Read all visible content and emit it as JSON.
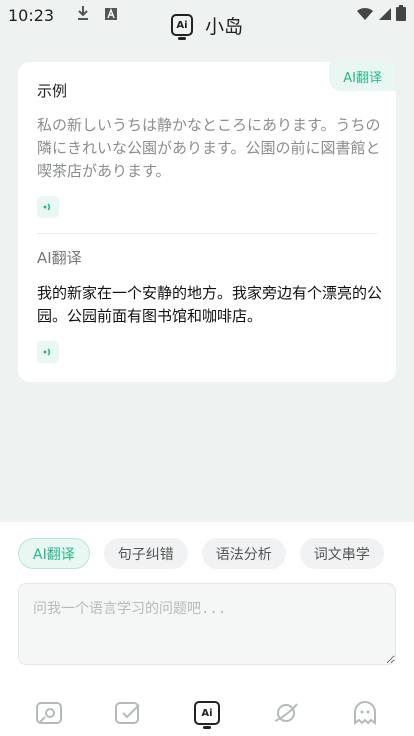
{
  "status": {
    "time": "10:23"
  },
  "header": {
    "logo_text": "Ai",
    "title": "小岛"
  },
  "card": {
    "badge": "AI翻译",
    "example_label": "示例",
    "japanese": " 私の新しいうちは静かなところにあります。うちの隣にきれいな公園があります。公園の前に図書館と喫茶店があります。",
    "translation_label": "AI翻译",
    "chinese": "我的新家在一个安静的地方。我家旁边有个漂亮的公园。公园前面有图书馆和咖啡店。"
  },
  "chips": [
    "AI翻译",
    "句子纠错",
    "语法分析",
    "词文串学"
  ],
  "input": {
    "placeholder": "问我一个语言学习的问题吧..."
  },
  "nav": {
    "items": [
      "photo-icon",
      "check-note-icon",
      "ai-icon",
      "planet-icon",
      "ghost-icon"
    ],
    "active": "ai-icon",
    "ai_label": "Ai"
  },
  "colors": {
    "accent": "#2bb58a",
    "background": "#eef2f1"
  }
}
